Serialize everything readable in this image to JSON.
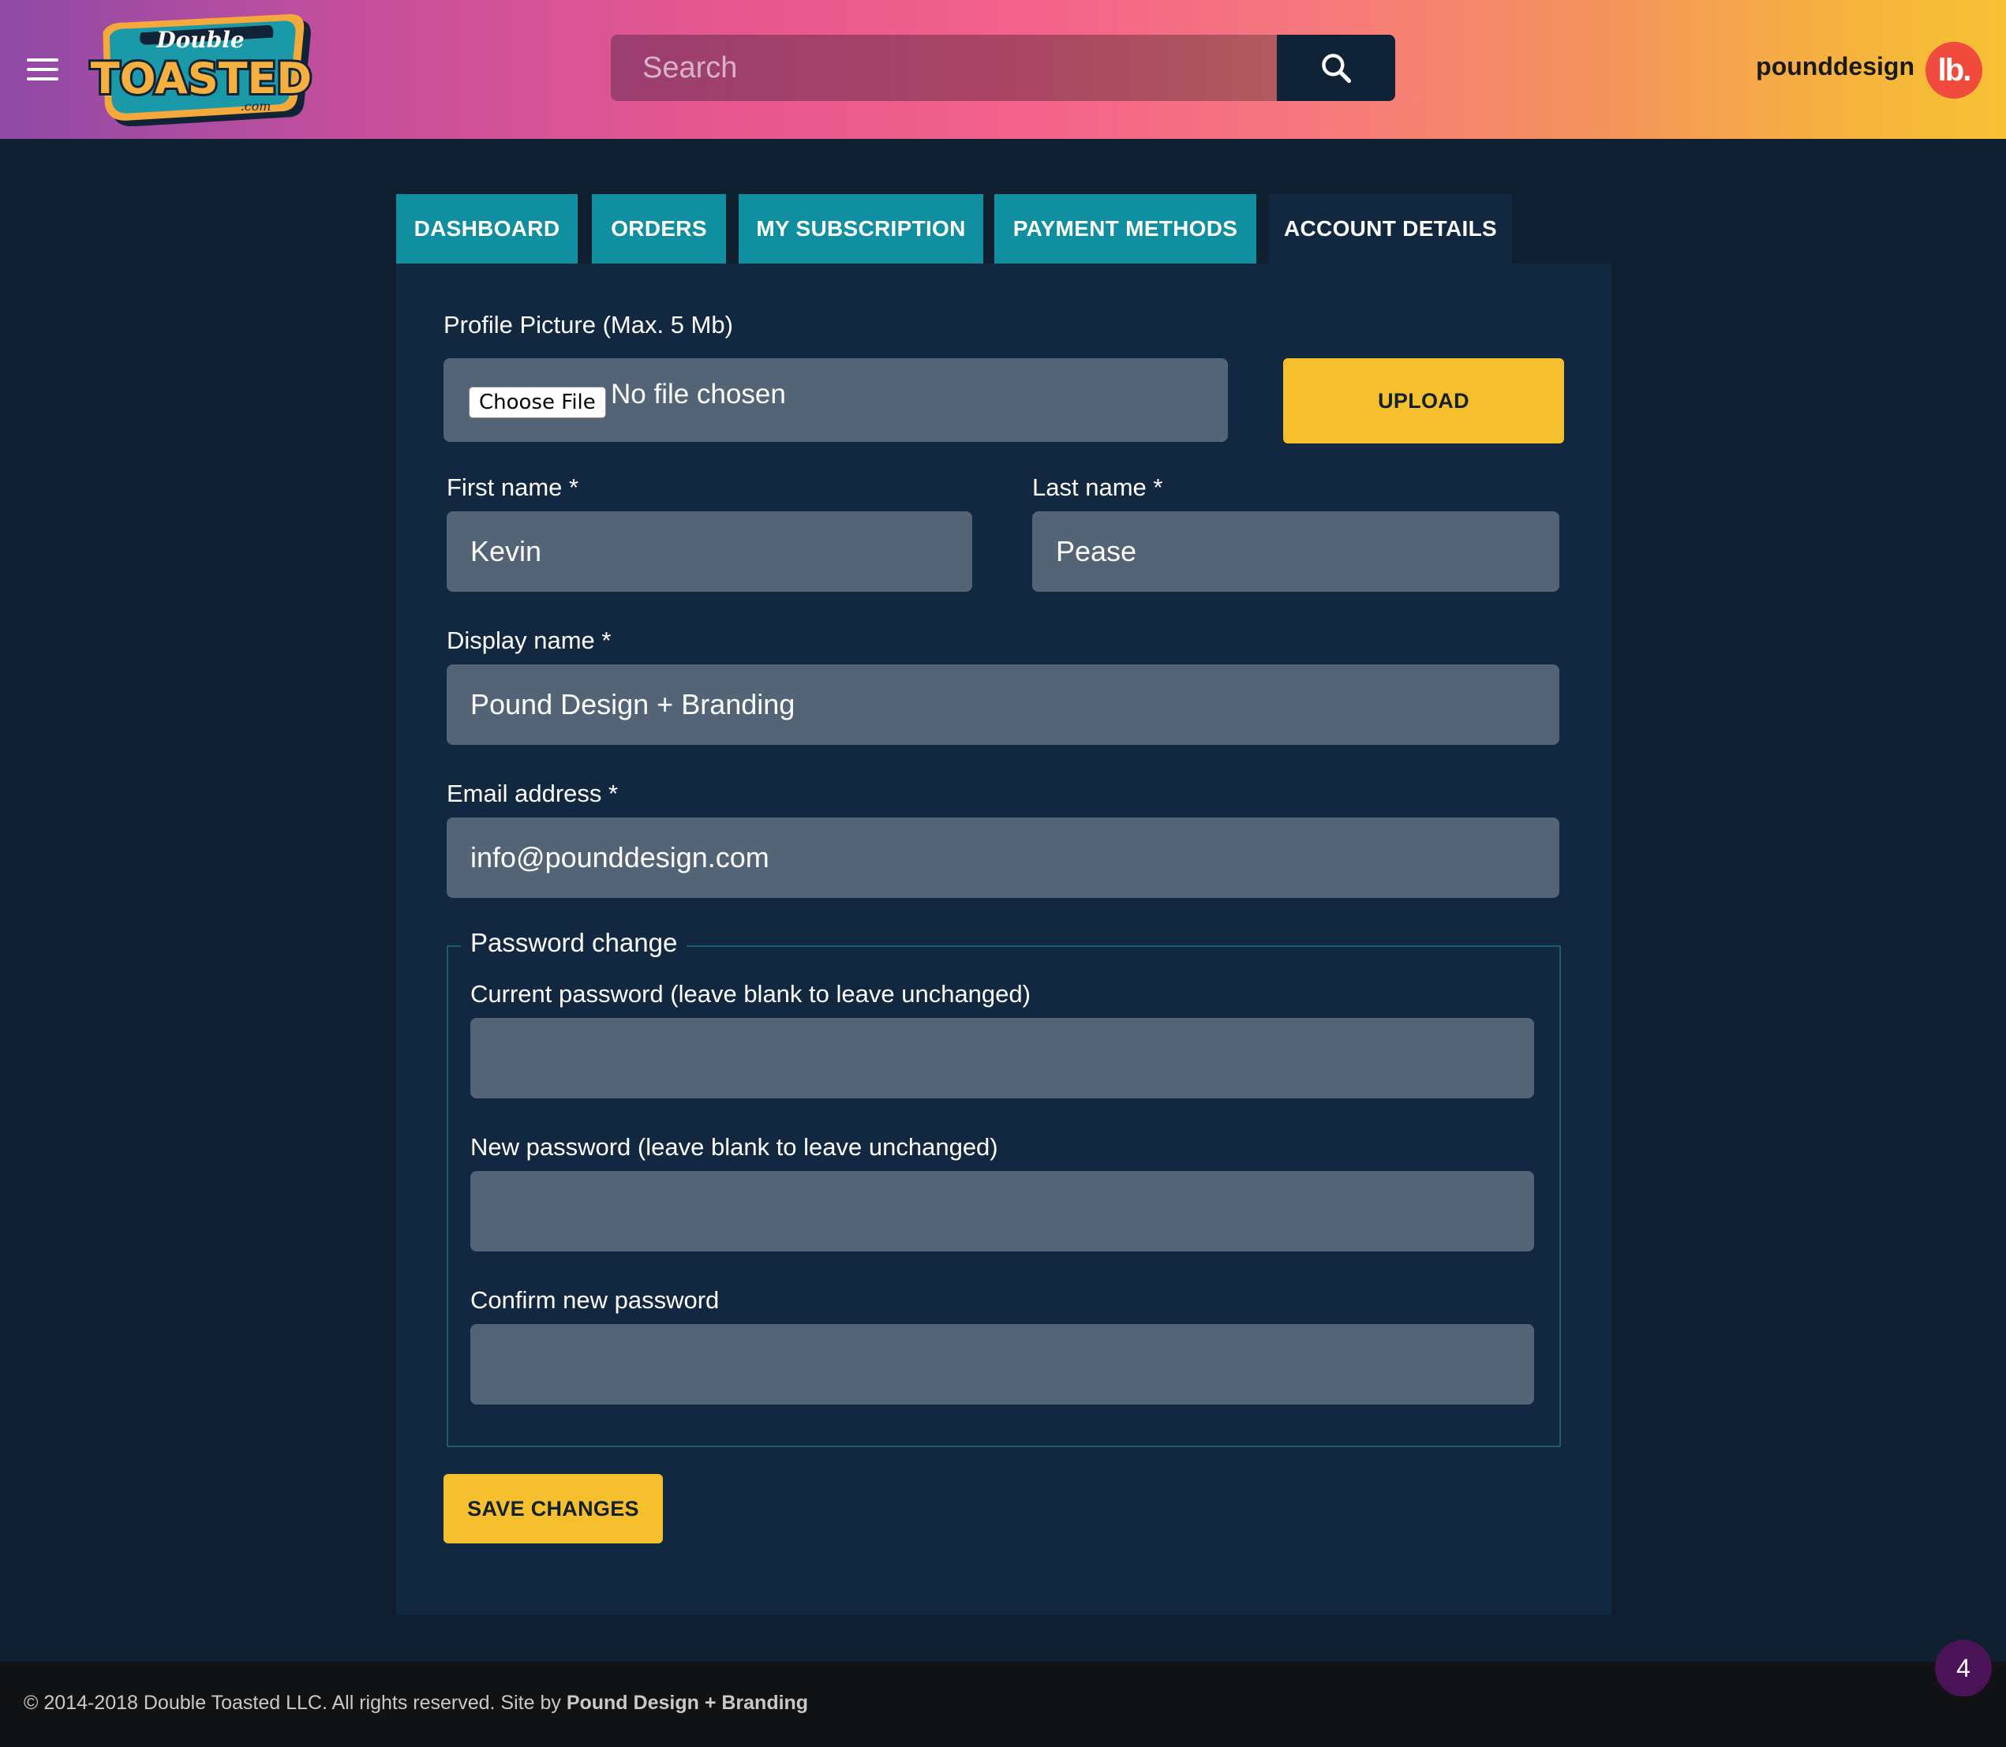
{
  "header": {
    "logo": {
      "top_text": "Double",
      "main_text": "TOASTED",
      "suffix_text": ".com"
    },
    "search": {
      "placeholder": "Search"
    },
    "username": "pounddesign",
    "avatar_text": "lb."
  },
  "tabs": [
    {
      "label": "DASHBOARD",
      "active": false
    },
    {
      "label": "ORDERS",
      "active": false
    },
    {
      "label": "MY SUBSCRIPTION",
      "active": false
    },
    {
      "label": "PAYMENT METHODS",
      "active": false
    },
    {
      "label": "ACCOUNT DETAILS",
      "active": true
    }
  ],
  "form": {
    "profile_picture": {
      "label": "Profile Picture (Max. 5 Mb)",
      "choose_file_label": "Choose File",
      "file_status": "No file chosen",
      "upload_label": "UPLOAD"
    },
    "first_name": {
      "label": "First name *",
      "value": "Kevin"
    },
    "last_name": {
      "label": "Last name *",
      "value": "Pease"
    },
    "display_name": {
      "label": "Display name *",
      "value": "Pound Design + Branding"
    },
    "email": {
      "label": "Email address *",
      "value": "info@pounddesign.com"
    },
    "password_change": {
      "legend": "Password change",
      "current_label": "Current password (leave blank to leave unchanged)",
      "current_value": "",
      "new_label": "New password (leave blank to leave unchanged)",
      "new_value": "",
      "confirm_label": "Confirm new password",
      "confirm_value": ""
    },
    "save_label": "SAVE CHANGES"
  },
  "footer": {
    "copyright_text": "© 2014-2018 Double Toasted LLC. All rights reserved. Site by ",
    "credit_link": "Pound Design + Branding"
  },
  "notification_count": "4",
  "colors": {
    "accent_yellow": "#f6bf2e",
    "tab_teal": "#0f8fa0",
    "panel_navy": "#122841",
    "field_gray": "#526475",
    "avatar_red": "#f04b3d",
    "badge_purple": "#4a1357"
  }
}
